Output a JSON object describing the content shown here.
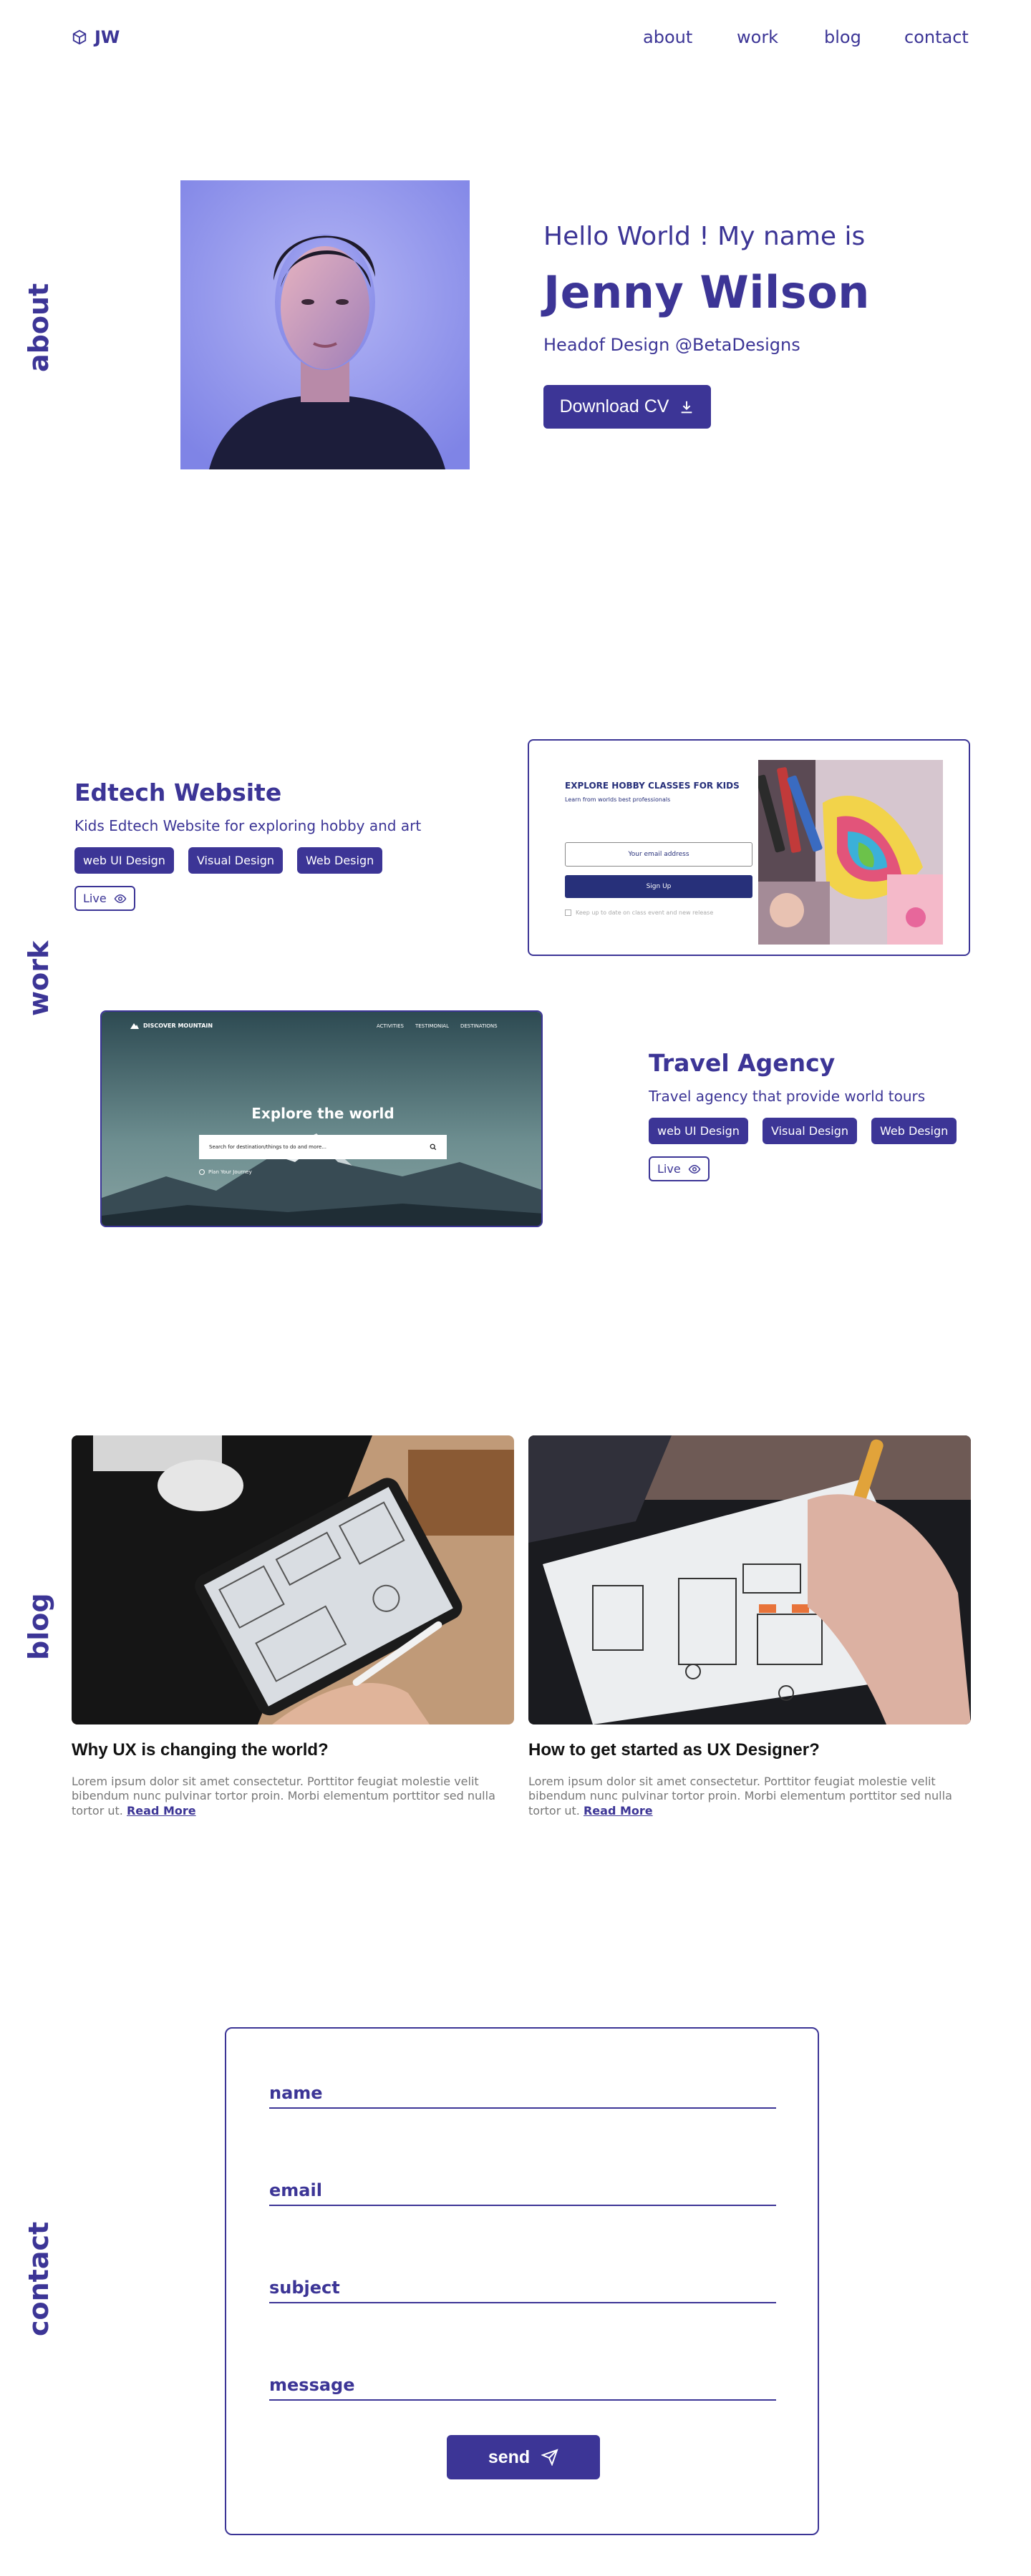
{
  "header": {
    "logo_text": "JW",
    "nav": [
      {
        "label": "about"
      },
      {
        "label": "work"
      },
      {
        "label": "blog"
      },
      {
        "label": "contact"
      }
    ]
  },
  "sections": {
    "about": "about",
    "work": "work",
    "blog": "blog",
    "contact": "contact"
  },
  "about": {
    "greeting": "Hello World ! My name is",
    "name": "Jenny Wilson",
    "role": "Headof Design @BetaDesigns",
    "cv_button": "Download CV"
  },
  "work": {
    "projects": [
      {
        "title": "Edtech Website",
        "description": "Kids Edtech Website for exploring hobby and art",
        "tags": [
          "web UI Design",
          "Visual Design",
          "Web Design"
        ],
        "live_label": "Live",
        "preview": {
          "heading": "EXPLORE HOBBY CLASSES FOR KIDS",
          "subheading": "Learn from worlds best professionals",
          "email_placeholder": "Your email address",
          "signup_label": "Sign Up",
          "checkbox_label": "Keep up to date on class event and new release"
        }
      },
      {
        "title": "Travel Agency",
        "description": "Travel agency that provide world tours",
        "tags": [
          "web UI Design",
          "Visual Design",
          "Web Design"
        ],
        "live_label": "Live",
        "preview": {
          "brand": "DISCOVER MOUNTAIN",
          "nav": [
            "ACTIVITIES",
            "TESTIMONIAL",
            "DESTINATIONS"
          ],
          "heading": "Explore the world",
          "search_placeholder": "Search for destination/things to do and more...",
          "footer_link": "Plan Your Journey"
        }
      }
    ]
  },
  "blog": {
    "posts": [
      {
        "title": "Why UX is changing the world?",
        "body": "Lorem ipsum dolor sit amet consectetur. Porttitor feugiat molestie velit bibendum nunc pulvinar tortor proin. Morbi elementum porttitor sed nulla tortor ut.",
        "read_more": "Read More"
      },
      {
        "title": "How to get started as UX Designer?",
        "body": "Lorem ipsum dolor sit amet consectetur. Porttitor feugiat molestie velit bibendum nunc pulvinar tortor proin. Morbi elementum porttitor sed nulla tortor ut.",
        "read_more": "Read More"
      }
    ]
  },
  "contact": {
    "fields": [
      "name",
      "email",
      "subject",
      "message"
    ],
    "send_label": "send"
  },
  "colors": {
    "accent": "#3c3596",
    "text_dark": "#111111",
    "text_muted": "#777777"
  },
  "icons": [
    "cube-icon",
    "download-icon",
    "eye-icon",
    "send-icon",
    "search-icon",
    "mountain-icon"
  ]
}
